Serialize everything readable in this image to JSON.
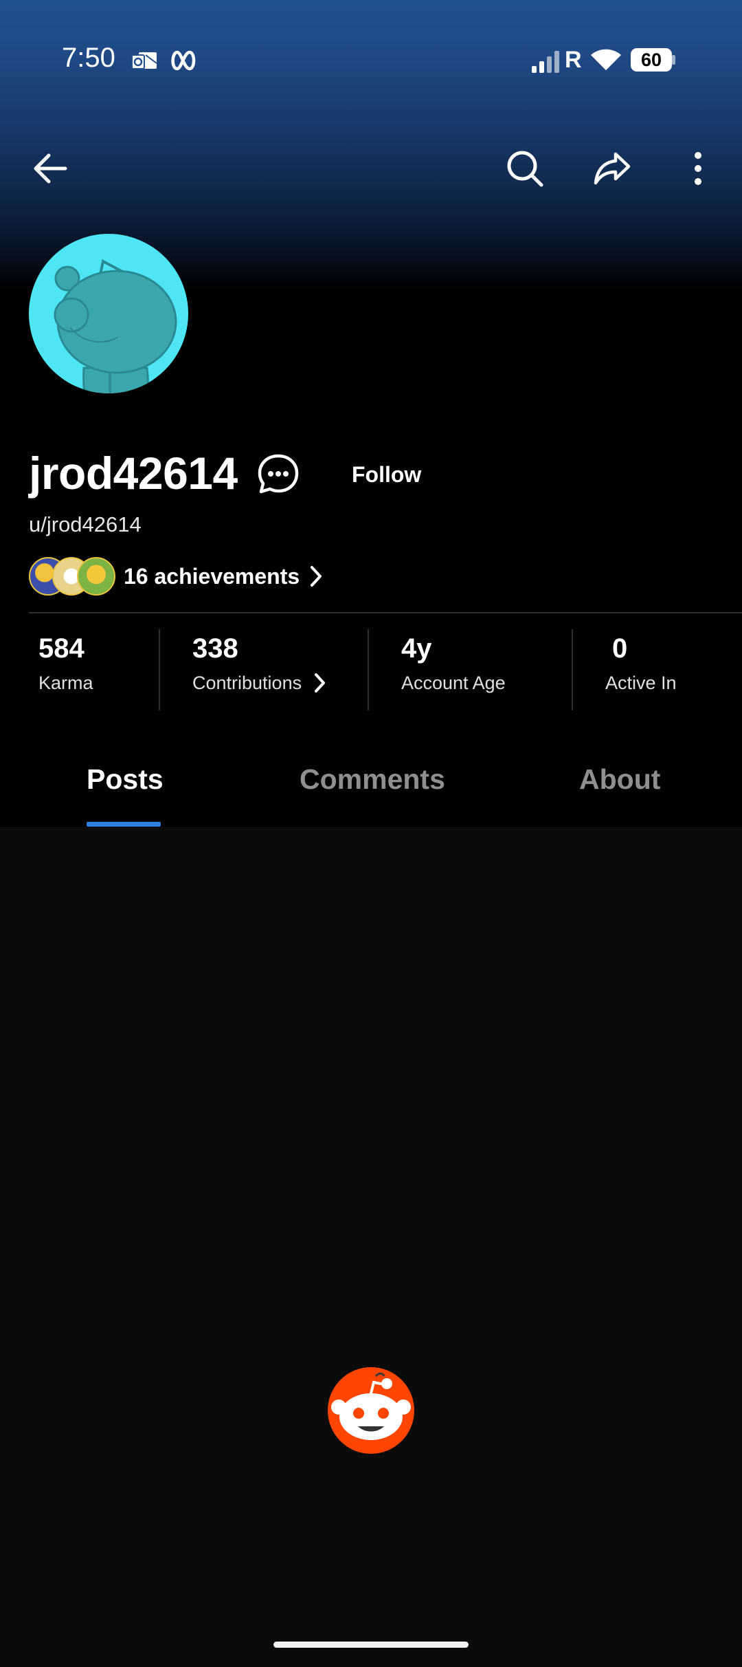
{
  "status_bar": {
    "time": "7:50",
    "battery": "60",
    "network_letter": "R"
  },
  "toolbar": {
    "back_icon": "back-arrow-icon",
    "search_icon": "search-icon",
    "share_icon": "share-icon",
    "more_icon": "more-vertical-icon"
  },
  "profile": {
    "display_name": "jrod42614",
    "handle": "u/jrod42614",
    "follow_label": "Follow",
    "achievements_label": "16 achievements"
  },
  "stats": [
    {
      "value": "584",
      "label": "Karma"
    },
    {
      "value": "338",
      "label": "Contributions"
    },
    {
      "value": "4y",
      "label": "Account Age"
    },
    {
      "value": "0",
      "label": "Active In"
    }
  ],
  "tabs": [
    {
      "label": "Posts",
      "active": true
    },
    {
      "label": "Comments",
      "active": false
    },
    {
      "label": "About",
      "active": false
    }
  ],
  "colors": {
    "accent": "#2e7fe0",
    "avatar_bg": "#4ee6f5",
    "reddit_orange": "#ff4500"
  }
}
